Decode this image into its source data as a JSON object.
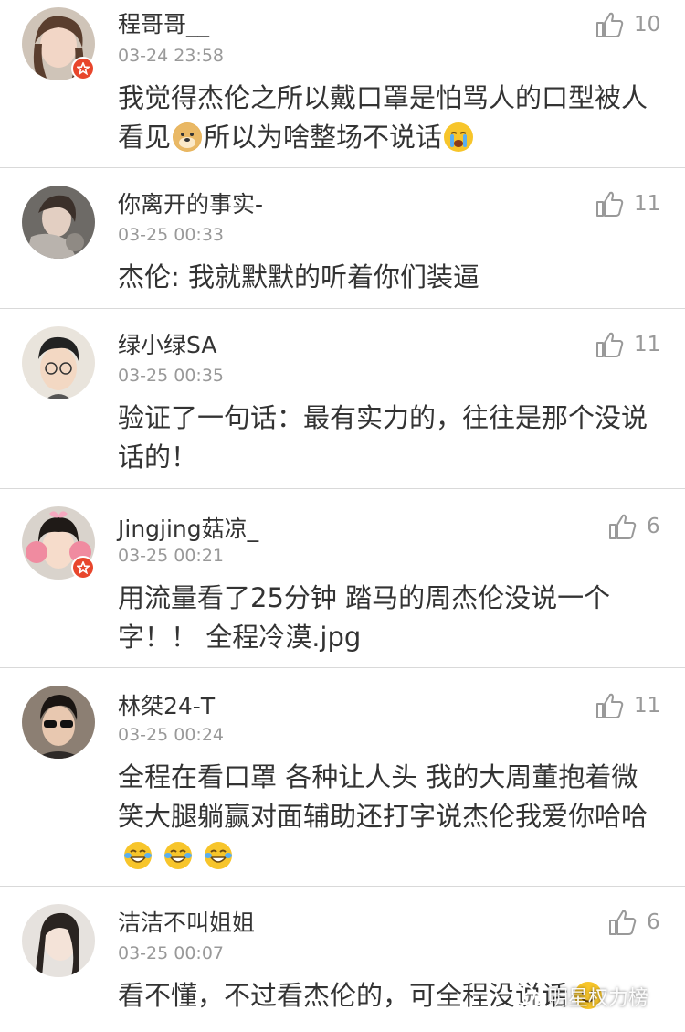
{
  "comments": [
    {
      "username": "程哥哥__",
      "time": "03-24 23:58",
      "likes": "10",
      "verified": true,
      "text_a": "我觉得杰伦之所以戴口罩是怕骂人的口型被人看见",
      "text_b": "所以为啥整场不说话",
      "emoji_a": "doge-emoji",
      "emoji_b": "crying-face-emoji"
    },
    {
      "username": "你离开的事实-",
      "time": "03-25 00:33",
      "likes": "11",
      "verified": false,
      "text": "杰伦: 我就默默的听着你们装逼"
    },
    {
      "username": "绿小绿SA",
      "time": "03-25 00:35",
      "likes": "11",
      "verified": false,
      "text": "验证了一句话：最有实力的，往往是那个没说话的！"
    },
    {
      "username": "Jingjing菇凉_",
      "time": "03-25 00:21",
      "likes": "6",
      "verified": true,
      "text": "用流量看了25分钟 踏马的周杰伦没说一个字！！ 全程冷漠.jpg"
    },
    {
      "username": "林桀24-T",
      "time": "03-25 00:24",
      "likes": "11",
      "verified": false,
      "text": "全程在看口罩 各种让人头 我的大周董抱着微笑大腿躺赢对面辅助还打字说杰伦我爱你哈哈",
      "emoji": "tears-of-joy-emoji"
    },
    {
      "username": "洁洁不叫姐姐",
      "time": "03-25 00:07",
      "likes": "6",
      "verified": false,
      "text": "看不懂，不过看杰伦的，可全程没说话",
      "emoji": "smile-emoji"
    }
  ],
  "watermark": "明星权力榜",
  "colors": {
    "text": "#333333",
    "meta": "#999999",
    "divider": "#d9d9d9",
    "badge": "#e8462c",
    "emoji": "#f7c52b"
  }
}
